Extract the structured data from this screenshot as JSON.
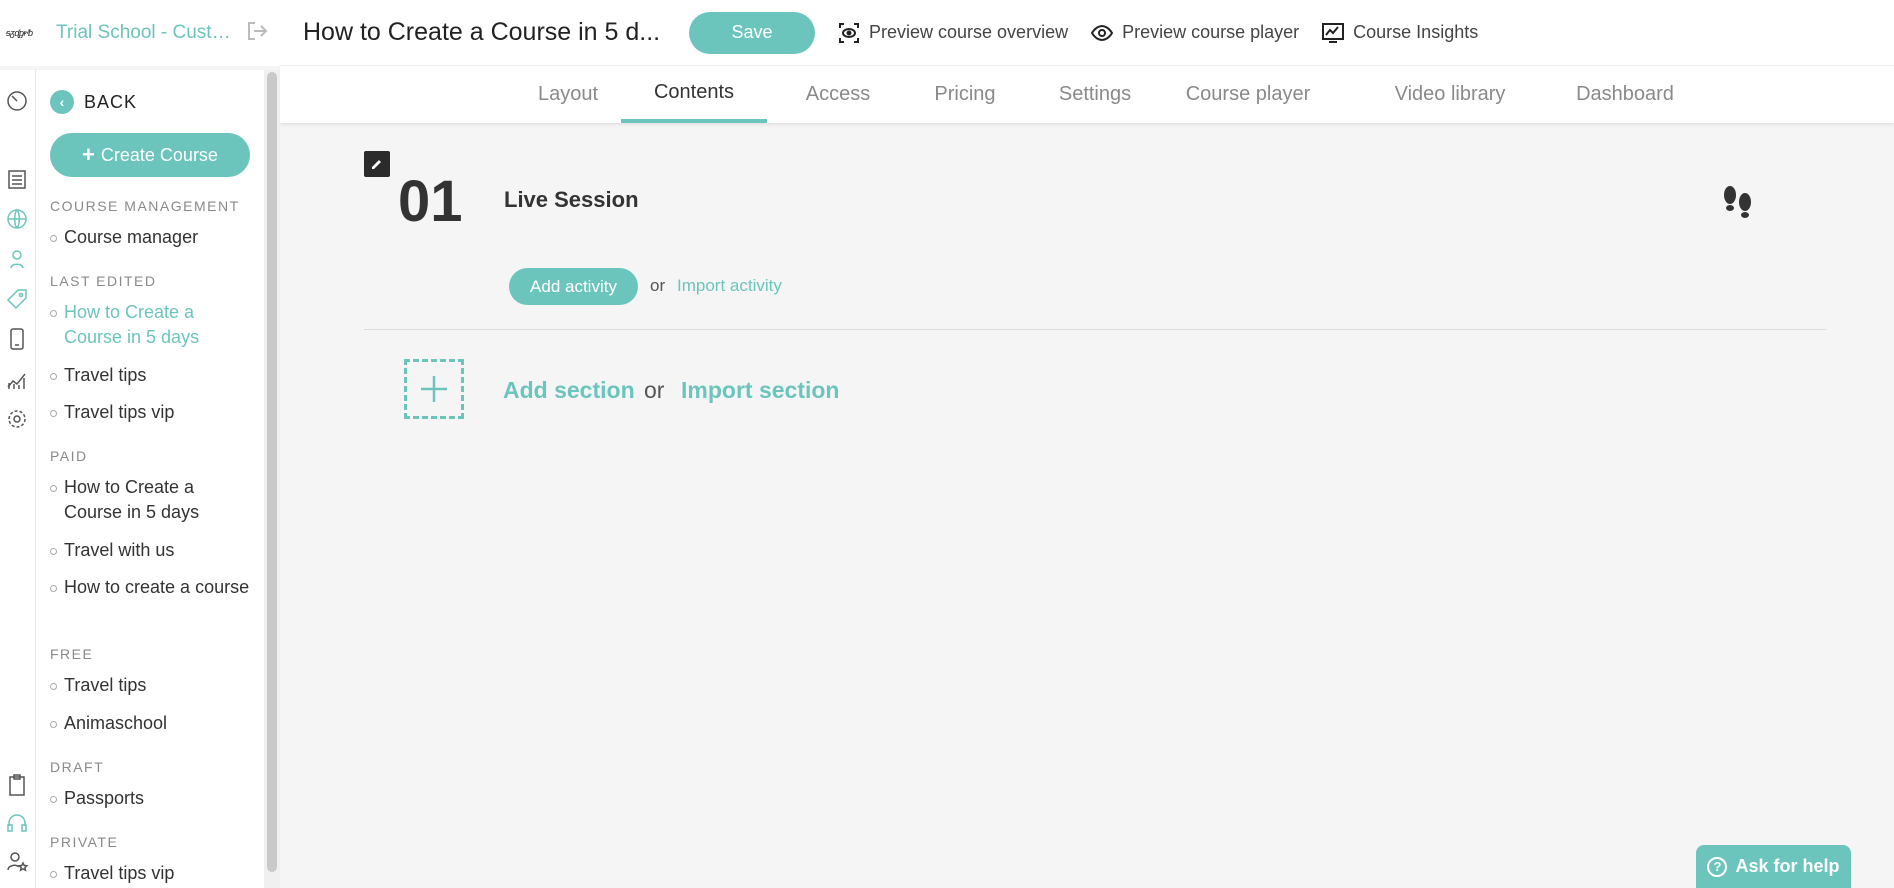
{
  "brand": {
    "logo_text": "ᵴᵹᶑᶈᵻᵸᵬ",
    "school_name": "Trial School - Custo..."
  },
  "header": {
    "course_title": "How to Create a Course in 5 d...",
    "save_label": "Save",
    "links": [
      "Preview course overview",
      "Preview course player",
      "Course Insights"
    ]
  },
  "tabs": [
    "Layout",
    "Contents",
    "Access",
    "Pricing",
    "Settings",
    "Course player",
    "Video library",
    "Dashboard"
  ],
  "active_tab": "Contents",
  "sidebar": {
    "back_label": "BACK",
    "create_label": "Create Course",
    "sections": [
      {
        "title": "COURSE MANAGEMENT",
        "items": [
          "Course manager"
        ]
      },
      {
        "title": "LAST EDITED",
        "items": [
          "How to Create a Course in 5 days",
          "Travel tips",
          "Travel tips vip"
        ]
      },
      {
        "title": "PAID",
        "items": [
          "How to Create a Course in 5 days",
          "Travel with us",
          "How to create a course"
        ]
      },
      {
        "title": "FREE",
        "items": [
          "Travel tips",
          "Animaschool"
        ]
      },
      {
        "title": "DRAFT",
        "items": [
          "Passports"
        ]
      },
      {
        "title": "PRIVATE",
        "items": [
          "Travel tips vip"
        ]
      }
    ]
  },
  "content": {
    "section_number": "01",
    "section_name": "Live Session",
    "add_activity": "Add activity",
    "or": "or",
    "import_activity": "Import activity",
    "add_section": "Add section",
    "import_section": "Import section"
  },
  "help_label": "Ask for help",
  "colors": {
    "accent": "#6cc5bc"
  },
  "icons": [
    "dashboard-icon",
    "pages-icon",
    "globe-icon",
    "users-icon",
    "tag-icon",
    "mobile-icon",
    "analytics-icon",
    "settings-icon",
    "clipboard-icon",
    "headset-icon",
    "star-user-icon"
  ]
}
